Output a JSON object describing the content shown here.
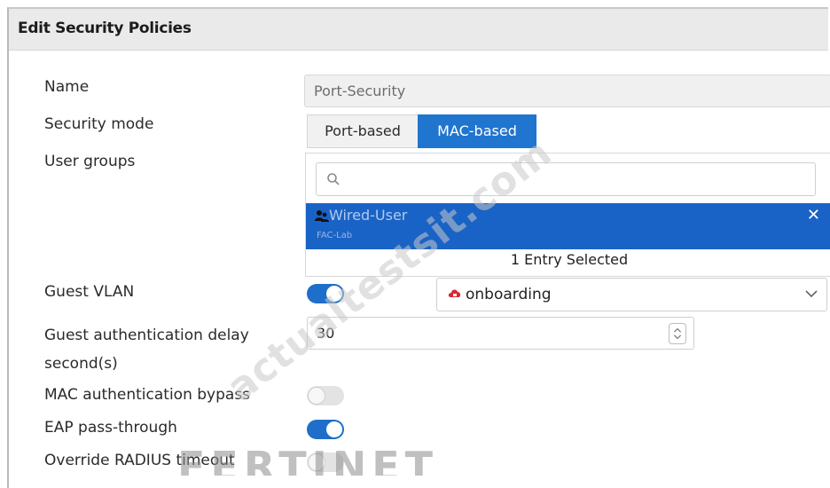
{
  "header": {
    "title": "Edit Security Policies"
  },
  "form": {
    "name_label": "Name",
    "name_value": "Port-Security",
    "security_mode_label": "Security mode",
    "security_mode_options": [
      "Port-based",
      "MAC-based"
    ],
    "security_mode_selected": "MAC-based",
    "user_groups_label": "User groups",
    "user_groups": {
      "search_placeholder": "",
      "selected": [
        {
          "name": "Wired-User",
          "source": "FAC-Lab"
        }
      ],
      "count_text": "1 Entry Selected"
    },
    "guest_vlan_label": "Guest VLAN",
    "guest_vlan_enabled": true,
    "guest_vlan_value": "onboarding",
    "guest_auth_delay_label_line1": "Guest authentication delay",
    "guest_auth_delay_label_line2": "second(s)",
    "guest_auth_delay_value": "30",
    "mac_bypass_label": "MAC authentication bypass",
    "mac_bypass_enabled": false,
    "eap_passthrough_label": "EAP pass-through",
    "eap_passthrough_enabled": true,
    "override_radius_label": "Override RADIUS timeout",
    "override_radius_enabled": false
  },
  "watermark": {
    "text": "actualtestsit.com"
  },
  "brand": {
    "logo_text": "FERTINET"
  },
  "colors": {
    "accent": "#2075cf",
    "selected_row": "#1a63c6",
    "header_bg": "#eaeaea"
  }
}
